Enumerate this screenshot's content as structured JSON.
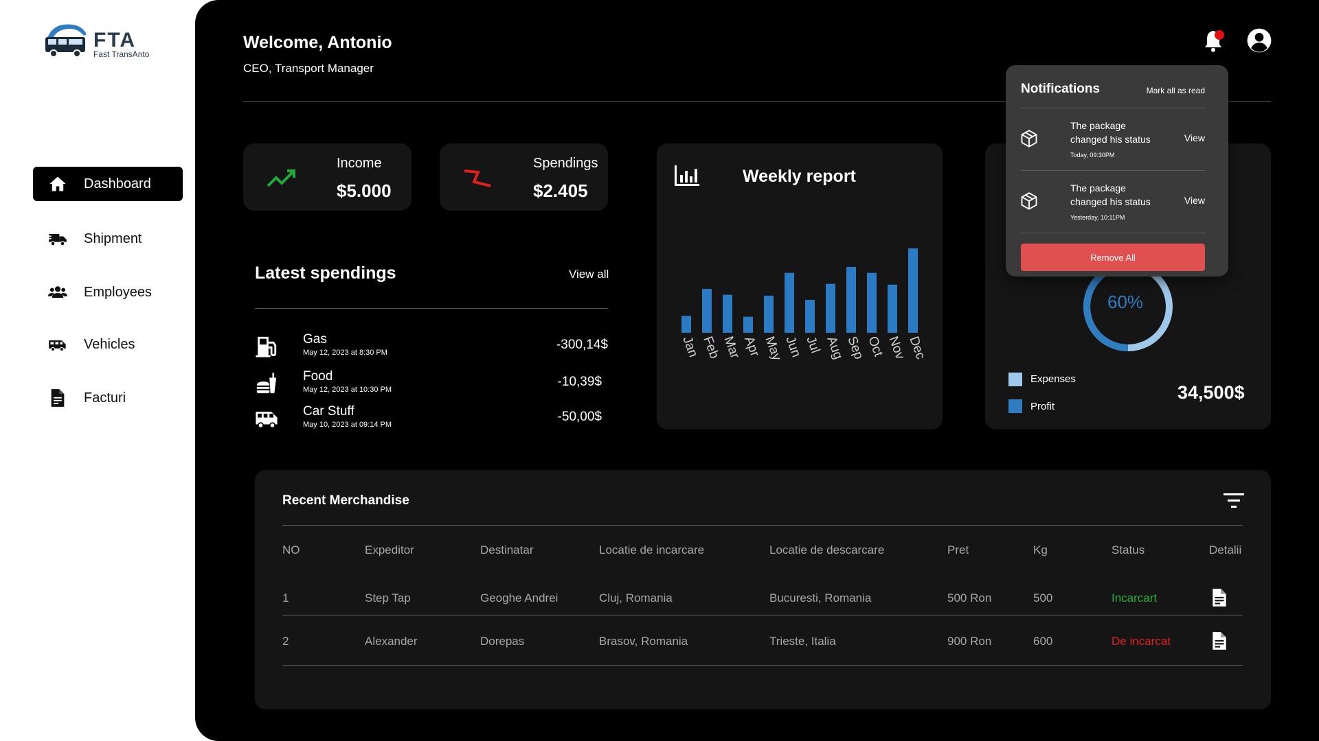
{
  "logo": {
    "abbr": "FTA",
    "name": "Fast TransAnto"
  },
  "sidebar": {
    "items": [
      {
        "label": "Dashboard",
        "icon": "home-icon",
        "active": true
      },
      {
        "label": "Shipment",
        "icon": "truck-icon"
      },
      {
        "label": "Employees",
        "icon": "people-icon"
      },
      {
        "label": "Vehicles",
        "icon": "van-icon"
      },
      {
        "label": "Facturi",
        "icon": "invoice-icon"
      }
    ]
  },
  "header": {
    "welcome": "Welcome, Antonio",
    "role": "CEO, Transport Manager",
    "bell_icon": "bell-icon",
    "avatar_icon": "user-circle-icon",
    "notification_dot_color": "#e11111"
  },
  "stats": {
    "income": {
      "title": "Income",
      "value": "$5.000",
      "icon": "trend-up-icon",
      "color": "#1faa3a"
    },
    "spendings": {
      "title": "Spendings",
      "value": "$2.405",
      "icon": "trend-down-icon",
      "color": "#e02020"
    }
  },
  "latest_spendings": {
    "title": "Latest spendings",
    "view_all": "View all",
    "items": [
      {
        "name": "Gas",
        "date": "May 12, 2023 at 8:30 PM",
        "amount": "-300,14$",
        "icon": "fuel-icon"
      },
      {
        "name": "Food",
        "date": "May 12, 2023 at 10:30 PM",
        "amount": "-10,39$",
        "icon": "food-icon"
      },
      {
        "name": "Car Stuff",
        "date": "May 10, 2023 at 09:14 PM",
        "amount": "-50,00$",
        "icon": "van-icon"
      }
    ]
  },
  "weekly_report": {
    "title": "Weekly report",
    "icon": "bar-chart-icon"
  },
  "chart_data": {
    "type": "bar",
    "categories": [
      "Jan",
      "Feb",
      "Mar",
      "Apr",
      "May",
      "Jun",
      "Jul",
      "Aug",
      "Sep",
      "Oct",
      "Nov",
      "Dec"
    ],
    "values": [
      20,
      52,
      45,
      19,
      44,
      71,
      39,
      58,
      78,
      71,
      57,
      100
    ],
    "color": "#2a7bc4"
  },
  "summary": {
    "percent": "60%",
    "percent_value": 60,
    "total": "34,500$",
    "legend": [
      {
        "label": "Expenses",
        "color": "#9ec9ea"
      },
      {
        "label": "Profit",
        "color": "#2f7cc0"
      }
    ]
  },
  "notifications": {
    "title": "Notifications",
    "mark_all": "Mark all as read",
    "items": [
      {
        "text": "The package changed his status",
        "time": "Today, 09:30PM",
        "action": "View",
        "icon": "package-icon"
      },
      {
        "text": "The package changed his status",
        "time": "Yesterday, 10:11PM",
        "action": "View",
        "icon": "package-icon"
      }
    ],
    "remove_all": "Remove All",
    "remove_color": "#e05050"
  },
  "merchandise": {
    "title": "Recent Merchandise",
    "filter_icon": "filter-icon",
    "columns": [
      "NO",
      "Expeditor",
      "Destinatar",
      "Locatie de incarcare",
      "Locatie de descarcare",
      "Pret",
      "Kg",
      "Status",
      "Detalii"
    ],
    "rows": [
      {
        "no": "1",
        "expeditor": "Step Tap",
        "destinatar": "Geoghe Andrei",
        "incarcare": "Cluj, Romania",
        "descarcare": "Bucuresti, Romania",
        "pret": "500 Ron",
        "kg": "500",
        "status": "Incarcart",
        "status_color": "#22b038",
        "detail_icon": "document-icon"
      },
      {
        "no": "2",
        "expeditor": "Alexander",
        "destinatar": "Dorepas",
        "incarcare": "Brasov, Romania",
        "descarcare": "Trieste, Italia",
        "pret": "900 Ron",
        "kg": "600",
        "status": "De incarcat",
        "status_color": "#e02020",
        "detail_icon": "document-icon"
      }
    ]
  }
}
